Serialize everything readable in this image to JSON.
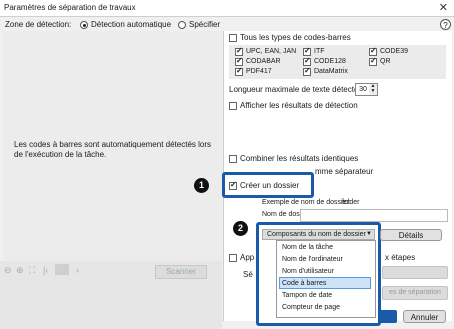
{
  "window": {
    "title": "Paramètres de séparation de travaux",
    "close": "✕"
  },
  "zone": {
    "label": "Zone de détection:",
    "options": [
      {
        "label": "Détection automatique",
        "selected": true
      },
      {
        "label": "Spécifier",
        "selected": false
      }
    ]
  },
  "help": "?",
  "left": {
    "message": "Les codes à barres sont automatiquement détectés lors de l'exécution de la tâche.",
    "scan": "Scanner"
  },
  "barcodes": {
    "all_label": "Tous les types de codes-barres",
    "types": [
      {
        "label": "UPC, EAN, JAN",
        "checked": true
      },
      {
        "label": "ITF",
        "checked": true
      },
      {
        "label": "CODE39",
        "checked": true
      },
      {
        "label": "CODABAR",
        "checked": true
      },
      {
        "label": "CODE128",
        "checked": true
      },
      {
        "label": "QR",
        "checked": true
      },
      {
        "label": "PDF417",
        "checked": true
      },
      {
        "label": "DataMatrix",
        "checked": true
      }
    ]
  },
  "max_length": {
    "label": "Longueur maximale de texte détecté:",
    "value": "30"
  },
  "show_results": "Afficher les résultats de détection",
  "combine": "Combiner les résultats identiques",
  "separator_tail": "mme séparateur",
  "create_folder": "Créer un dossier",
  "example_label": "Exemple de nom de dossier:",
  "example_value": "folder",
  "folder_name_label": "Nom de dossier:",
  "folder_components": "Composants du nom de dossier",
  "details": "Détails",
  "dropdown_items": [
    "Nom de la tâche",
    "Nom de l'ordinateur",
    "Nom d'utilisateur",
    "Code à barres",
    "Tampon de date",
    "Compteur de page"
  ],
  "apply_partial": "App",
  "steps_partial": "x étapes",
  "se_partial": "Sé",
  "separation_partial": "es de séparation",
  "cancel": "Annuler",
  "badges": {
    "one": "1",
    "two": "2"
  },
  "colors": {
    "highlight": "#1a5aa8",
    "selected_item": "#cde3f7"
  }
}
